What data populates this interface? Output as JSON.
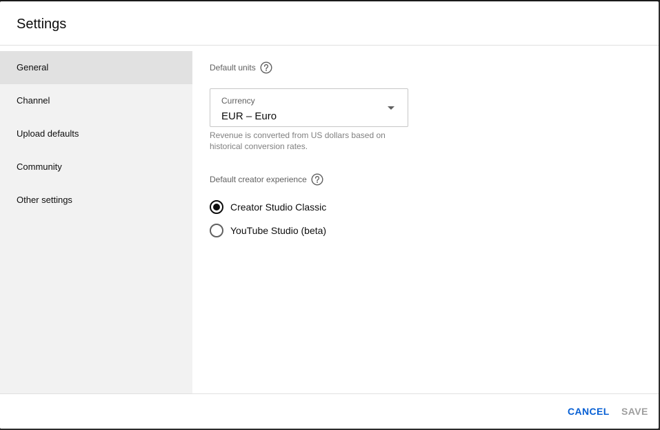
{
  "dialog": {
    "title": "Settings"
  },
  "sidebar": {
    "items": [
      {
        "label": "General",
        "active": true
      },
      {
        "label": "Channel",
        "active": false
      },
      {
        "label": "Upload defaults",
        "active": false
      },
      {
        "label": "Community",
        "active": false
      },
      {
        "label": "Other settings",
        "active": false
      }
    ]
  },
  "general": {
    "default_units": {
      "label": "Default units",
      "help_icon": "question-circle-icon",
      "currency": {
        "label": "Currency",
        "value": "EUR – Euro",
        "helper": "Revenue is converted from US dollars based on historical conversion rates."
      }
    },
    "creator_experience": {
      "label": "Default creator experience",
      "help_icon": "question-circle-icon",
      "options": [
        {
          "label": "Creator Studio Classic",
          "selected": true
        },
        {
          "label": "YouTube Studio (beta)",
          "selected": false
        }
      ]
    }
  },
  "footer": {
    "cancel_label": "CANCEL",
    "save_label": "SAVE"
  },
  "colors": {
    "accent": "#065fd4",
    "sidebar_bg": "#f2f2f2",
    "sidebar_active": "#e1e1e1",
    "disabled": "#9e9e9e"
  }
}
